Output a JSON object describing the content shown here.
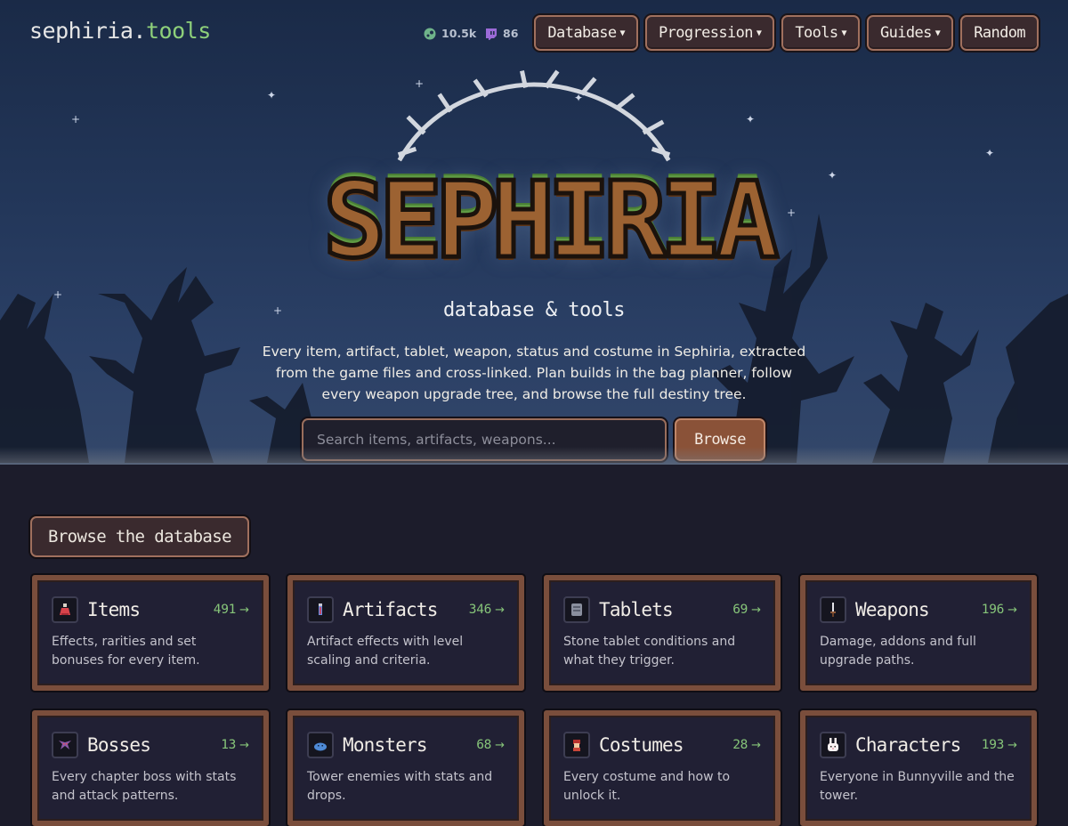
{
  "brand": {
    "name_main": "sephiria",
    "name_dot": ".",
    "name_accent": "tools"
  },
  "stats": [
    {
      "icon": "steam-icon",
      "value": "10.5k"
    },
    {
      "icon": "twitch-icon",
      "value": "86"
    }
  ],
  "nav": [
    {
      "label": "Database",
      "dropdown": true
    },
    {
      "label": "Progression",
      "dropdown": true
    },
    {
      "label": "Tools",
      "dropdown": true
    },
    {
      "label": "Guides",
      "dropdown": true
    },
    {
      "label": "Random",
      "dropdown": false
    }
  ],
  "hero": {
    "logo": "SEPHIRIA",
    "subtitle": "database & tools",
    "intro": "Every item, artifact, tablet, weapon, status and costume in Sephiria, extracted from the game files and cross-linked. Plan builds in the bag planner, follow every weapon upgrade tree, and browse the full destiny tree.",
    "search_placeholder": "Search items, artifacts, weapons...",
    "browse_label": "Browse"
  },
  "section": {
    "title": "Browse the database"
  },
  "cards": [
    {
      "title": "Items",
      "count": "491",
      "desc": "Effects, rarities and set bonuses for every item.",
      "icon": "potion-icon"
    },
    {
      "title": "Artifacts",
      "count": "346",
      "desc": "Artifact effects with level scaling and criteria.",
      "icon": "vial-icon"
    },
    {
      "title": "Tablets",
      "count": "69",
      "desc": "Stone tablet conditions and what they trigger.",
      "icon": "tablet-icon"
    },
    {
      "title": "Weapons",
      "count": "196",
      "desc": "Damage, addons and full upgrade paths.",
      "icon": "sword-icon"
    },
    {
      "title": "Bosses",
      "count": "13",
      "desc": "Every chapter boss with stats and attack patterns.",
      "icon": "boss-icon"
    },
    {
      "title": "Monsters",
      "count": "68",
      "desc": "Tower enemies with stats and drops.",
      "icon": "slime-icon"
    },
    {
      "title": "Costumes",
      "count": "28",
      "desc": "Every costume and how to unlock it.",
      "icon": "costume-icon"
    },
    {
      "title": "Characters",
      "count": "193",
      "desc": "Everyone in Bunnyville and the tower.",
      "icon": "bunny-icon"
    }
  ],
  "colors": {
    "accent_green": "#86c479",
    "frame_brown": "#7a4e3c",
    "button_brown": "#8a5238",
    "page_bg": "#1c1c2b"
  }
}
